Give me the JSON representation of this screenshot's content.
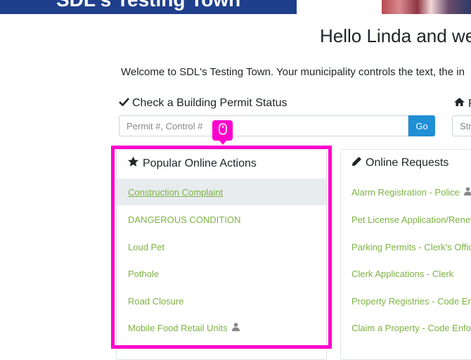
{
  "banner": {
    "title": "SDL's Testing Town"
  },
  "greeting": "Hello Linda and we",
  "welcome": "Welcome to SDL's Testing Town. Your municipality controls the text, the in",
  "permit": {
    "label": "Check a Building Permit Status",
    "placeholder": "Permit #, Control #",
    "go_label": "Go"
  },
  "address": {
    "label_fragment": "F",
    "placeholder": "Str"
  },
  "popular": {
    "title": "Popular Online Actions",
    "items": [
      "Construction Complaint",
      "DANGEROUS CONDITION",
      "Loud Pet",
      "Pothole",
      "Road Closure",
      "Mobile Food Retail Units"
    ]
  },
  "requests": {
    "title": "Online Requests",
    "items": [
      "Alarm Registration - Police",
      "Pet License Application/Renew",
      "Parking Permits - Clerk's Office",
      "Clerk Applications - Clerk",
      "Property Registries - Code Enfo",
      "Claim a Property - Code Enforc"
    ]
  },
  "colors": {
    "link": "#7cb342",
    "primary": "#1f8fd6",
    "highlight": "#ff00cc",
    "banner": "#1f3f8c"
  }
}
